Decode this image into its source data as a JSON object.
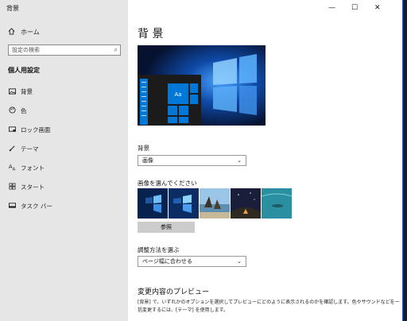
{
  "window": {
    "title": "背景",
    "controls": {
      "minimize": "—",
      "maximize": "☐",
      "close": "✕"
    }
  },
  "sidebar": {
    "home_label": "ホーム",
    "search_placeholder": "設定の検索",
    "section_title": "個人用設定",
    "items": [
      {
        "label": "背景",
        "icon": "picture-icon"
      },
      {
        "label": "色",
        "icon": "palette-icon"
      },
      {
        "label": "ロック画面",
        "icon": "lock-screen-icon"
      },
      {
        "label": "テーマ",
        "icon": "theme-brush-icon"
      },
      {
        "label": "フォント",
        "icon": "font-icon"
      },
      {
        "label": "スタート",
        "icon": "start-grid-icon"
      },
      {
        "label": "タスク バー",
        "icon": "taskbar-icon"
      }
    ]
  },
  "main": {
    "page_title": "背 景",
    "preview_tile_text": "Aa",
    "background_label": "背景",
    "background_value": "画像",
    "choose_image_label": "画像を選んでください",
    "browse_label": "参照",
    "fit_label": "調整方法を選ぶ",
    "fit_value": "ページ幅に合わせる",
    "preview_heading": "変更内容のプレビュー",
    "preview_description": "[背景] で、いずれかのオプションを選択してプレビューにどのように表示されるのかを確認します。色やサウンドなどを一括変更するには、[テーマ] を使用します。",
    "thumbnails": [
      "windows-blue-1",
      "windows-blue-2",
      "beach-rocks",
      "night-sky-tent",
      "underwater-swimmer"
    ]
  },
  "colors": {
    "accent": "#0078d7",
    "sidebar_bg": "#e6e6e6"
  }
}
